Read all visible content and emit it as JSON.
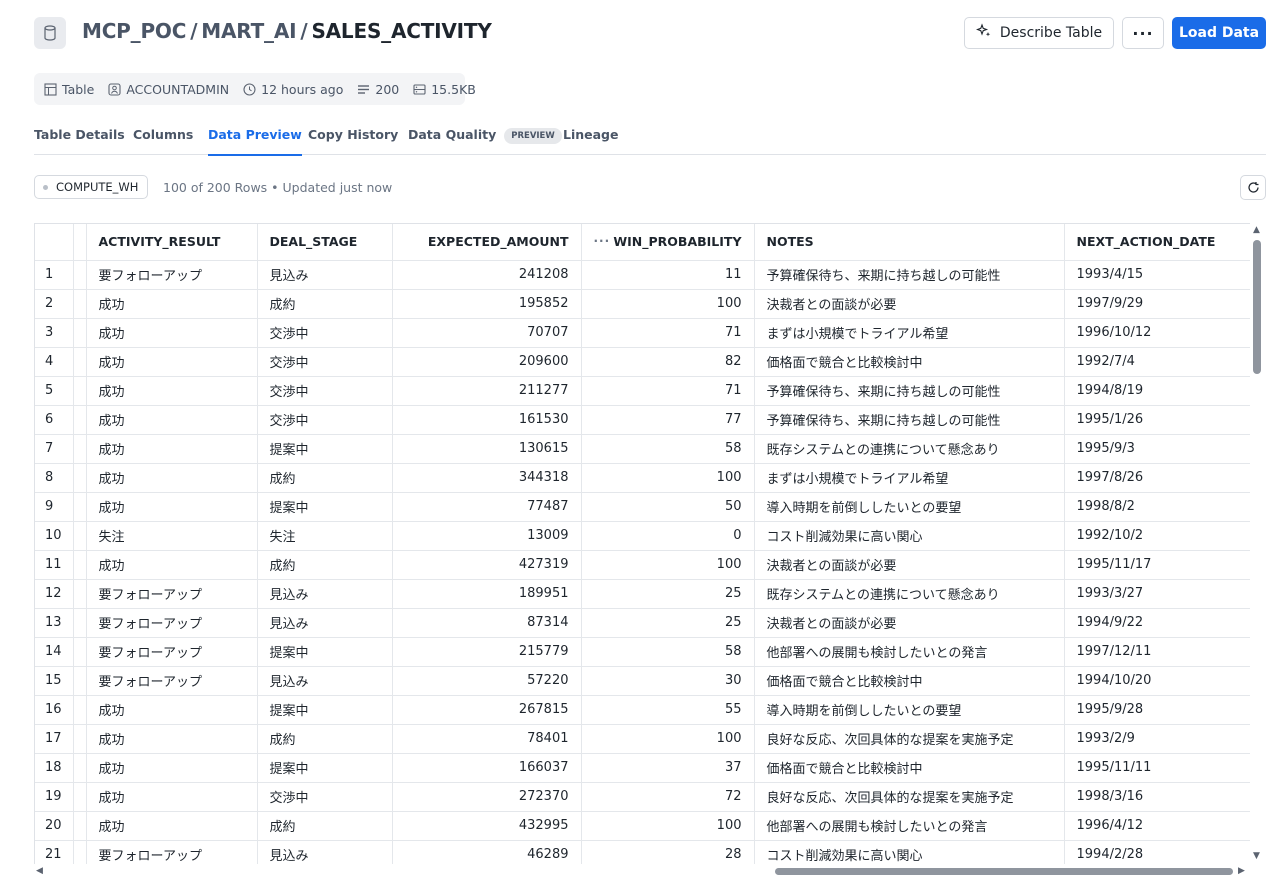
{
  "header": {
    "breadcrumb": [
      "MCP_POC",
      "MART_AI",
      "SALES_ACTIVITY"
    ],
    "separator": "/",
    "describe_label": "Describe Table",
    "more_label": "···",
    "load_label": "Load Data"
  },
  "meta": {
    "type": "Table",
    "owner": "ACCOUNTADMIN",
    "updated": "12 hours ago",
    "rows": "200",
    "size": "15.5KB"
  },
  "tabs": [
    {
      "label": "Table Details"
    },
    {
      "label": "Columns"
    },
    {
      "label": "Data Preview",
      "active": true
    },
    {
      "label": "Copy History"
    },
    {
      "label": "Data Quality",
      "badge": "PREVIEW"
    },
    {
      "label": "Lineage"
    }
  ],
  "toolbar": {
    "warehouse": "COMPUTE_WH",
    "row_info": "100 of 200 Rows • Updated just now"
  },
  "table": {
    "columns": [
      "ACTIVITY_RESULT",
      "DEAL_STAGE",
      "EXPECTED_AMOUNT",
      "WIN_PROBABILITY",
      "NOTES",
      "NEXT_ACTION_DATE"
    ],
    "column_menu": "···",
    "rows": [
      [
        "1",
        "要フォローアップ",
        "見込み",
        "241208",
        "11",
        "予算確保待ち、来期に持ち越しの可能性",
        "1993/4/15"
      ],
      [
        "2",
        "成功",
        "成約",
        "195852",
        "100",
        "決裁者との面談が必要",
        "1997/9/29"
      ],
      [
        "3",
        "成功",
        "交渉中",
        "70707",
        "71",
        "まずは小規模でトライアル希望",
        "1996/10/12"
      ],
      [
        "4",
        "成功",
        "交渉中",
        "209600",
        "82",
        "価格面で競合と比較検討中",
        "1992/7/4"
      ],
      [
        "5",
        "成功",
        "交渉中",
        "211277",
        "71",
        "予算確保待ち、来期に持ち越しの可能性",
        "1994/8/19"
      ],
      [
        "6",
        "成功",
        "交渉中",
        "161530",
        "77",
        "予算確保待ち、来期に持ち越しの可能性",
        "1995/1/26"
      ],
      [
        "7",
        "成功",
        "提案中",
        "130615",
        "58",
        "既存システムとの連携について懸念あり",
        "1995/9/3"
      ],
      [
        "8",
        "成功",
        "成約",
        "344318",
        "100",
        "まずは小規模でトライアル希望",
        "1997/8/26"
      ],
      [
        "9",
        "成功",
        "提案中",
        "77487",
        "50",
        "導入時期を前倒ししたいとの要望",
        "1998/8/2"
      ],
      [
        "10",
        "失注",
        "失注",
        "13009",
        "0",
        "コスト削減効果に高い関心",
        "1992/10/2"
      ],
      [
        "11",
        "成功",
        "成約",
        "427319",
        "100",
        "決裁者との面談が必要",
        "1995/11/17"
      ],
      [
        "12",
        "要フォローアップ",
        "見込み",
        "189951",
        "25",
        "既存システムとの連携について懸念あり",
        "1993/3/27"
      ],
      [
        "13",
        "要フォローアップ",
        "見込み",
        "87314",
        "25",
        "決裁者との面談が必要",
        "1994/9/22"
      ],
      [
        "14",
        "要フォローアップ",
        "提案中",
        "215779",
        "58",
        "他部署への展開も検討したいとの発言",
        "1997/12/11"
      ],
      [
        "15",
        "要フォローアップ",
        "見込み",
        "57220",
        "30",
        "価格面で競合と比較検討中",
        "1994/10/20"
      ],
      [
        "16",
        "成功",
        "提案中",
        "267815",
        "55",
        "導入時期を前倒ししたいとの要望",
        "1995/9/28"
      ],
      [
        "17",
        "成功",
        "成約",
        "78401",
        "100",
        "良好な反応、次回具体的な提案を実施予定",
        "1993/2/9"
      ],
      [
        "18",
        "成功",
        "提案中",
        "166037",
        "37",
        "価格面で競合と比較検討中",
        "1995/11/11"
      ],
      [
        "19",
        "成功",
        "交渉中",
        "272370",
        "72",
        "良好な反応、次回具体的な提案を実施予定",
        "1998/3/16"
      ],
      [
        "20",
        "成功",
        "成約",
        "432995",
        "100",
        "他部署への展開も検討したいとの発言",
        "1996/4/12"
      ],
      [
        "21",
        "要フォローアップ",
        "見込み",
        "46289",
        "28",
        "コスト削減効果に高い関心",
        "1994/2/28"
      ]
    ]
  },
  "colors": {
    "accent": "#1a6ce8",
    "text": "#1e252d",
    "muted": "#4a5566",
    "border": "#dfe2e7"
  }
}
